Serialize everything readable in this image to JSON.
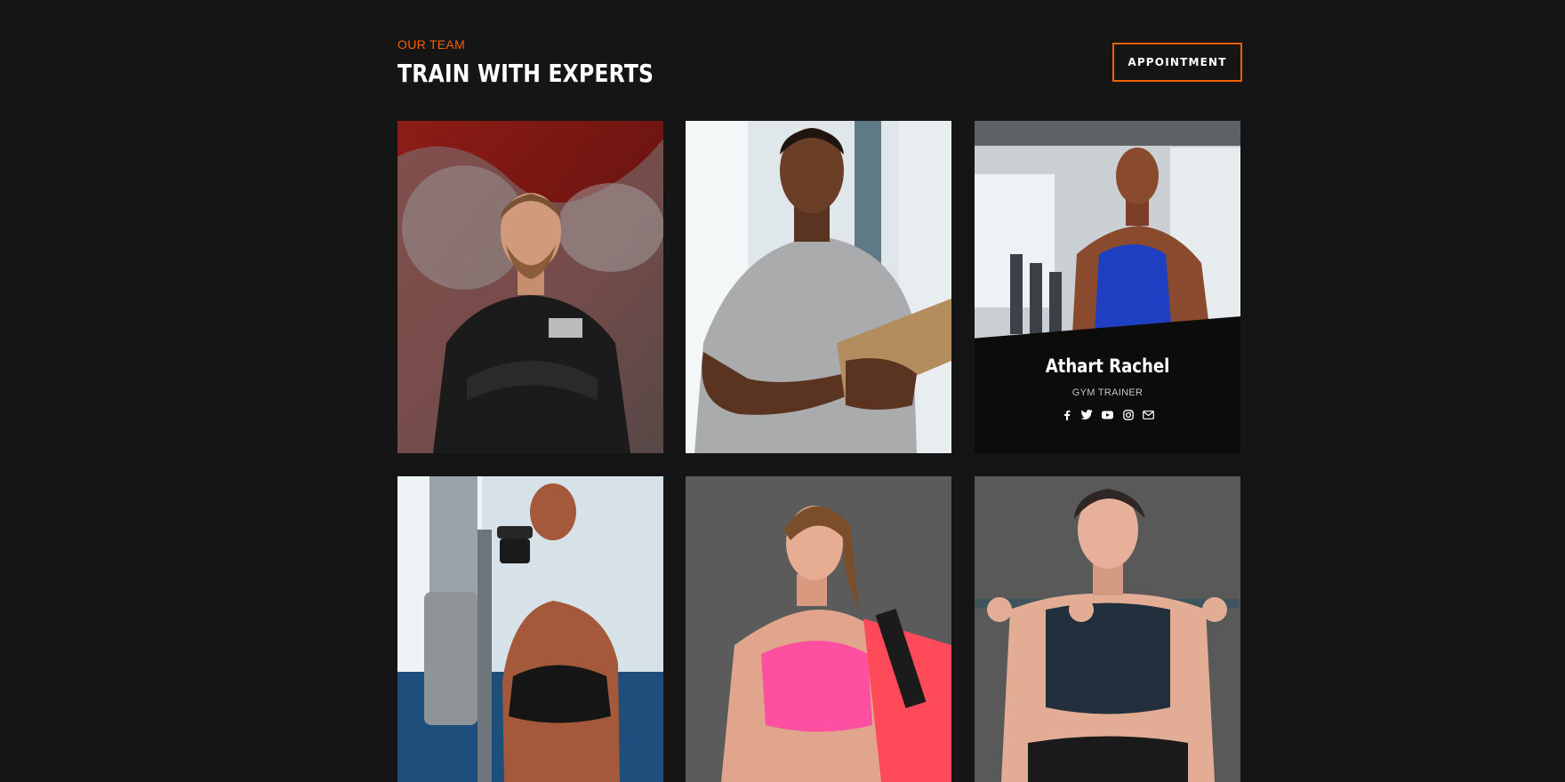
{
  "header": {
    "eyebrow": "OUR TEAM",
    "title": "TRAIN WITH EXPERTS",
    "button_label": "APPOINTMENT"
  },
  "colors": {
    "accent": "#f36100",
    "background": "#151515",
    "card_overlay": "#0c0c0c"
  },
  "team": [
    {
      "photo": "trainer-photo-arms-crossed"
    },
    {
      "photo": "trainer-photo-clipboard"
    },
    {
      "photo": "trainer-photo-blue-tank",
      "name": "Athart Rachel",
      "role": "GYM TRAINER",
      "socials": [
        "facebook-icon",
        "twitter-icon",
        "youtube-icon",
        "instagram-icon",
        "envelope-icon"
      ]
    },
    {
      "photo": "trainer-photo-dumbbell"
    },
    {
      "photo": "trainer-photo-pink-top"
    },
    {
      "photo": "trainer-photo-barbell"
    }
  ]
}
